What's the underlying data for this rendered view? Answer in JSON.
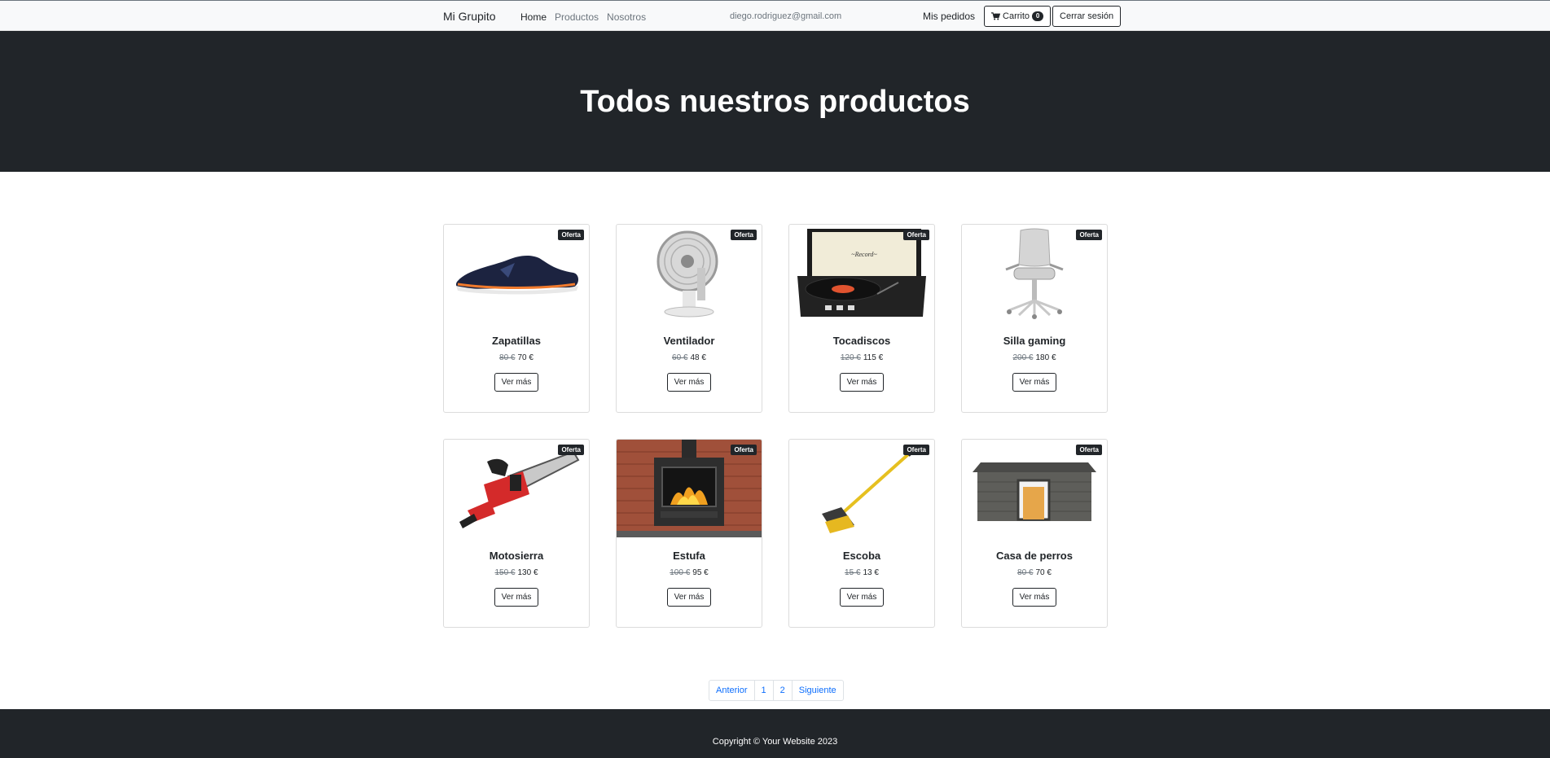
{
  "navbar": {
    "brand": "Mi Grupito",
    "links": [
      "Home",
      "Productos",
      "Nosotros"
    ],
    "user_email": "diego.rodriguez@gmail.com",
    "orders": "Mis pedidos",
    "cart_label": "Carrito",
    "cart_count": "0",
    "logout": "Cerrar sesión"
  },
  "hero": {
    "title": "Todos nuestros productos"
  },
  "products": [
    {
      "name": "Zapatillas",
      "old_price": "80 €",
      "price": "70 €",
      "badge": "Oferta",
      "button": "Ver más",
      "icon": "sneaker-image"
    },
    {
      "name": "Ventilador",
      "old_price": "60 €",
      "price": "48 €",
      "badge": "Oferta",
      "button": "Ver más",
      "icon": "fan-image"
    },
    {
      "name": "Tocadiscos",
      "old_price": "120 €",
      "price": "115 €",
      "badge": "Oferta",
      "button": "Ver más",
      "icon": "record-player-image"
    },
    {
      "name": "Silla gaming",
      "old_price": "200 €",
      "price": "180 €",
      "badge": "Oferta",
      "button": "Ver más",
      "icon": "office-chair-image"
    },
    {
      "name": "Motosierra",
      "old_price": "150 €",
      "price": "130 €",
      "badge": "Oferta",
      "button": "Ver más",
      "icon": "chainsaw-image"
    },
    {
      "name": "Estufa",
      "old_price": "100 €",
      "price": "95 €",
      "badge": "Oferta",
      "button": "Ver más",
      "icon": "stove-image"
    },
    {
      "name": "Escoba",
      "old_price": "15 €",
      "price": "13 €",
      "badge": "Oferta",
      "button": "Ver más",
      "icon": "broom-image"
    },
    {
      "name": "Casa de perros",
      "old_price": "80 €",
      "price": "70 €",
      "badge": "Oferta",
      "button": "Ver más",
      "icon": "doghouse-image"
    }
  ],
  "pagination": [
    "Anterior",
    "1",
    "2",
    "Siguiente"
  ],
  "footer": {
    "text": "Copyright © Your Website 2023"
  },
  "colors": {
    "dark": "#212529",
    "link_blue": "#0d6efd",
    "navbar_bg": "#f8f9fa"
  }
}
